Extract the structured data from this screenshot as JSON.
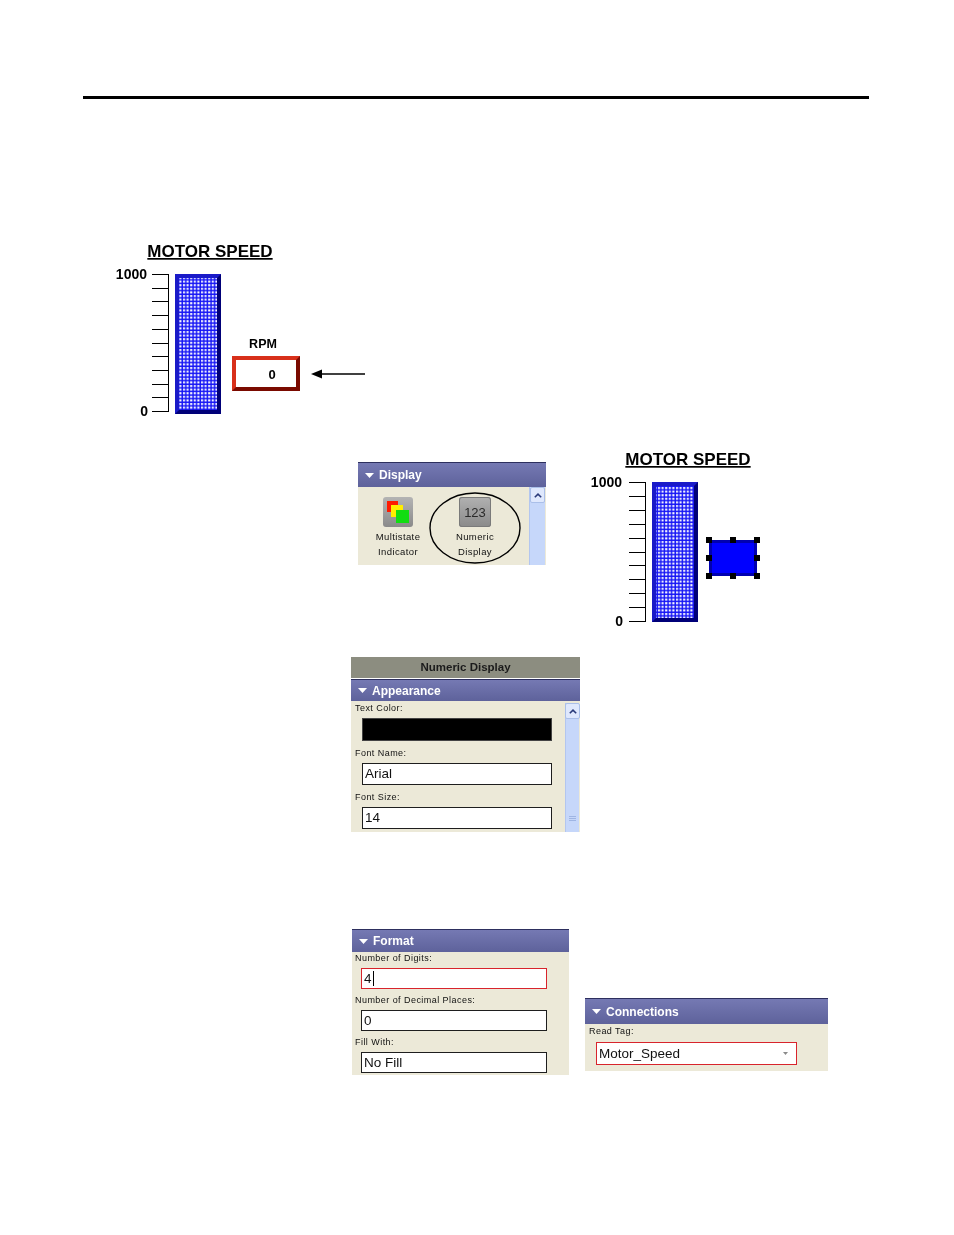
{
  "figure_1": {
    "title": "MOTOR SPEED",
    "scale_max": "1000",
    "scale_min": "0",
    "unit_label": "RPM",
    "display_value": "0"
  },
  "toolbox": {
    "section": {
      "title": "Display",
      "expanded": true
    },
    "items": [
      {
        "kind": "multistate",
        "label": "Multistate Indicator",
        "circled": false
      },
      {
        "kind": "numeric",
        "icon_text": "123",
        "label": "Numeric Display",
        "circled": true
      }
    ]
  },
  "figure_2": {
    "title": "MOTOR SPEED",
    "scale_max": "1000",
    "scale_min": "0",
    "display_selected": true
  },
  "properties": {
    "title": "Numeric Display",
    "section": {
      "title": "Appearance",
      "expanded": true
    },
    "fields": [
      {
        "kind": "color",
        "label": "Text Color:",
        "color": "#000000"
      },
      {
        "kind": "text",
        "label": "Font Name:",
        "value": "Arial"
      },
      {
        "kind": "text",
        "label": "Font Size:",
        "value": "14"
      }
    ]
  },
  "format": {
    "section": {
      "title": "Format",
      "expanded": true
    },
    "fields": [
      {
        "kind": "text",
        "label": "Number of Digits:",
        "value": "4",
        "highlighted": true,
        "caret": true
      },
      {
        "kind": "text",
        "label": "Number of Decimal Places:",
        "value": "0",
        "highlighted": false,
        "caret": false
      },
      {
        "kind": "text",
        "label": "Fill With:",
        "value": "No Fill",
        "highlighted": false,
        "caret": false
      }
    ]
  },
  "connections": {
    "section": {
      "title": "Connections",
      "expanded": true
    },
    "fields": [
      {
        "kind": "dropdown",
        "label": "Read Tag:",
        "value": "Motor_Speed",
        "highlighted": true
      }
    ]
  }
}
